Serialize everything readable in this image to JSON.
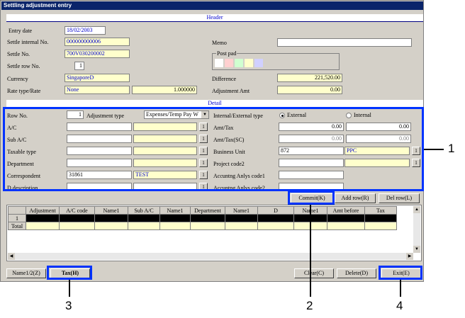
{
  "window": {
    "title": "Settling adjustment entry"
  },
  "header": {
    "section_label": "Header"
  },
  "fields": {
    "entry_date": {
      "label": "Entry date",
      "value": "18/02/2003"
    },
    "settle_internal_no": {
      "label": "Settle internal No.",
      "value": "000000000006"
    },
    "settle_no": {
      "label": "Settle No.",
      "value": "700V030200002"
    },
    "settle_row_no": {
      "label": "Settle row No.",
      "value": "1"
    },
    "currency": {
      "label": "Currency",
      "value": "SingaporeD"
    },
    "rate_type": {
      "label": "Rate type/Rate",
      "value": "None",
      "rate": "1.000000"
    },
    "memo": {
      "label": "Memo",
      "value": ""
    },
    "post_pad": {
      "label": "Post pad"
    },
    "difference": {
      "label": "Difference",
      "value": "221,520.00"
    },
    "adjustment_amt": {
      "label": "Adjustment Amt",
      "value": "0.00"
    }
  },
  "detail": {
    "section_label": "Detail",
    "row_no": {
      "label": "Row No.",
      "value": "1"
    },
    "adjustment_type": {
      "label": "Adjustment type",
      "value": "Expenses/Temp Pay W"
    },
    "ac": {
      "label": "A/C"
    },
    "sub_ac": {
      "label": "Sub A/C"
    },
    "taxable_type": {
      "label": "Taxable type"
    },
    "department": {
      "label": "Department"
    },
    "correspondent": {
      "label": "Correspondent",
      "value": "31861",
      "name": "TEST"
    },
    "d_description": {
      "label": "D description"
    },
    "internal_external": {
      "label": "Internal/External type",
      "external": "External",
      "internal": "Internal"
    },
    "amt_tax": {
      "label": "Amt/Tax",
      "amt": "0.00",
      "tax": "0.00"
    },
    "amt_tax_sc": {
      "label": "Amt/Tax(SC)",
      "amt": "0.00",
      "tax": "0.00"
    },
    "business_unit": {
      "label": "Business Unit",
      "value": "872",
      "name": "PPC"
    },
    "project_code2": {
      "label": "Project code2"
    },
    "accounting1": {
      "label": "Accuntng Anlys code1"
    },
    "accounting2": {
      "label": "Accuntng Anlys code2"
    },
    "mini_btn": "1"
  },
  "detail_buttons": {
    "commit": "Commit(K)",
    "add_row": "Add row(R)",
    "del_row": "Del row(L)"
  },
  "grid": {
    "columns": [
      "",
      "Adjustment",
      "A/C code",
      "Name1",
      "Sub A/C",
      "Name1",
      "Department",
      "Name1",
      "D",
      "Name1",
      "Amt before",
      "Tax"
    ],
    "rows": [
      {
        "label": "1"
      }
    ],
    "total_label": "Total"
  },
  "bottom_buttons": {
    "name12": "Name1/2(Z)",
    "tax": "Tax(H)",
    "clear": "Clear(C)",
    "delete": "Delete(D)",
    "exit": "Exit(E)"
  },
  "callouts": {
    "c1": "1",
    "c2": "2",
    "c3": "3",
    "c4": "4"
  },
  "colors": {
    "title_bar": "#0a246a",
    "highlight": "#0033ff",
    "input_yellow": "#ffffcc",
    "window_bg": "#d4d0c8",
    "section_text": "#0000cc"
  },
  "post_pad_swatches": [
    "#ffffff",
    "#ffd0d0",
    "#d0ffd0",
    "#ffffcc",
    "#d0d0ff"
  ]
}
